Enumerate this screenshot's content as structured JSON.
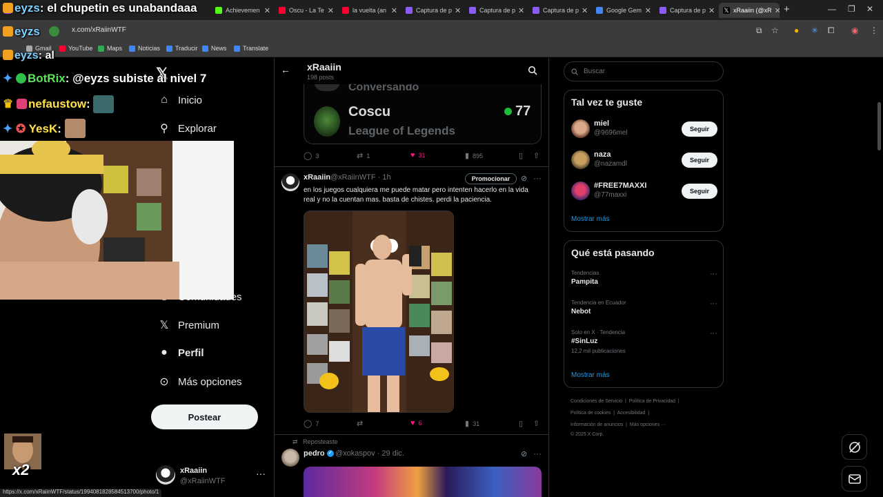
{
  "browser": {
    "tabs": [
      {
        "label": "eyzs: el chupetin es unabandaaa",
        "color": "#9146ff"
      },
      {
        "label": "Achievemen",
        "color": "#53fc18"
      },
      {
        "label": "Oscu - La Te",
        "color": "#ff0033"
      },
      {
        "label": "la vuelta (an",
        "color": "#ff0033"
      },
      {
        "label": "Captura de p",
        "color": "#8b5cf6"
      },
      {
        "label": "Captura de p",
        "color": "#8b5cf6"
      },
      {
        "label": "Captura de p",
        "color": "#8b5cf6"
      },
      {
        "label": "Google Gem",
        "color": "#4285f4"
      },
      {
        "label": "Captura de p",
        "color": "#8b5cf6"
      },
      {
        "label": "xRaaiin (@xR",
        "color": "#ffffff"
      }
    ],
    "url": "x.com/xRaiinWTF",
    "bookmarks": [
      "Gmail",
      "YouTube",
      "Maps",
      "Noticias",
      "Traducir",
      "News",
      "Translate"
    ],
    "status_url": "https://x.com/xRaiinWTF/status/1994081828584513700/photo/1"
  },
  "stream_overlay": {
    "title": "el chupetin es unabandaaa",
    "chat": [
      {
        "user": "eyzs",
        "message": "al"
      },
      {
        "user": "BotRix",
        "message": "@eyzs subiste al nivel 7"
      },
      {
        "user": "nefaustow",
        "message": ""
      },
      {
        "user": "YesK",
        "message": ""
      }
    ],
    "multiplier": "x2"
  },
  "nav": {
    "items": [
      {
        "label": "Inicio",
        "icon": "home-icon"
      },
      {
        "label": "Explorar",
        "icon": "search-icon"
      },
      {
        "label": "Comunidades",
        "icon": "communities-icon"
      },
      {
        "label": "Premium",
        "icon": "x-logo-icon"
      },
      {
        "label": "Perfil",
        "icon": "person-icon"
      },
      {
        "label": "Más opciones",
        "icon": "more-circle-icon"
      }
    ],
    "post_button": "Postear",
    "account": {
      "name": "xRaaiin",
      "handle": "@xRaiinWTF"
    }
  },
  "timeline": {
    "title": "xRaaiin",
    "posts_count": "198 posts",
    "embed": {
      "status": "Conversando",
      "name": "Coscu",
      "game": "League of Legends",
      "viewers": "77"
    },
    "first_actions": {
      "replies": "3",
      "reposts": "1",
      "likes": "31",
      "views": "895"
    },
    "tweet": {
      "name": "xRaaiin",
      "meta": "@xRaiinWTF · 1h",
      "promote": "Promocionar",
      "text": "en los juegos cualquiera me puede matar pero intenten hacerlo en la vida real y no la cuentan mas. basta de chistes. perdi la paciencia.",
      "replies": "7",
      "reposts": "",
      "likes": "6",
      "views": "31"
    },
    "repost_label": "Reposteaste",
    "next_tweet": {
      "name": "pedro",
      "meta": "@xokaspov · 29 dic."
    }
  },
  "sidebar": {
    "search_placeholder": "Buscar",
    "who_to_follow": {
      "title": "Tal vez te guste",
      "users": [
        {
          "name": "miel",
          "handle": "@9696mel",
          "button": "Seguir"
        },
        {
          "name": "naza",
          "handle": "@nazamdl",
          "button": "Seguir"
        },
        {
          "name": "#FREE7MAXXI",
          "handle": "@77maxxi",
          "button": "Seguir"
        }
      ],
      "show_more": "Mostrar más"
    },
    "trends": {
      "title": "Qué está pasando",
      "items": [
        {
          "context": "Tendencias",
          "topic": "Pampita",
          "count": ""
        },
        {
          "context": "Tendencia en Ecuador",
          "topic": "Nebot",
          "count": ""
        },
        {
          "context": "Solo en X · Tendencia",
          "topic": "#SinLuz",
          "count": "12,2 mil publicaciones"
        }
      ],
      "show_more": "Mostrar más"
    },
    "footer": {
      "line1": [
        "Condiciones de Servicio",
        "Política de Privacidad"
      ],
      "line2": [
        "Política de cookies",
        "Accesibilidad"
      ],
      "line3": [
        "Información de anuncios",
        "Más opciones ···"
      ],
      "copyright": "© 2025 X Corp."
    }
  },
  "colors": {
    "accent": "#1d9bf0",
    "like": "#f91880",
    "online": "#1dbd3a"
  }
}
